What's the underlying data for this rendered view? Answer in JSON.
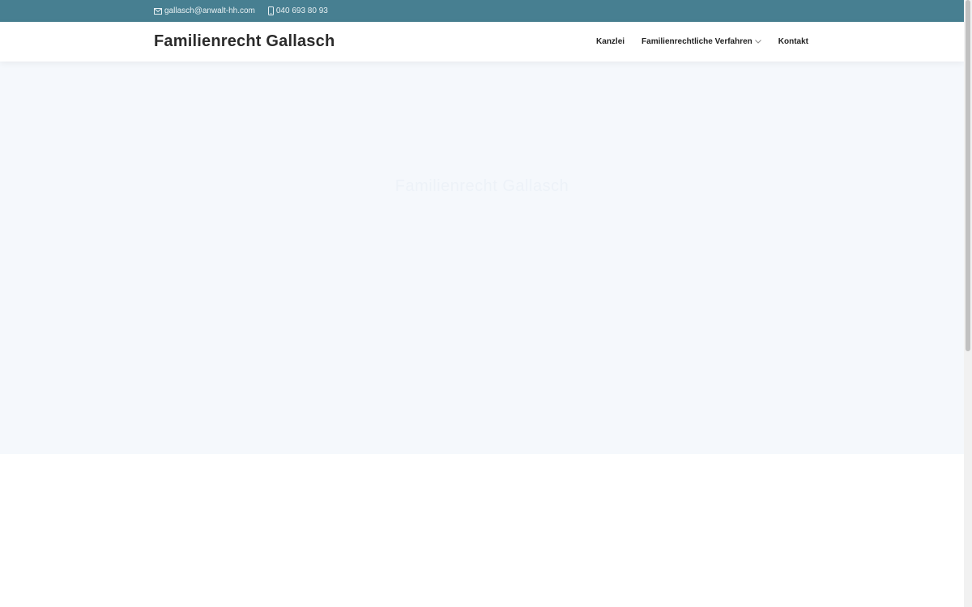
{
  "topbar": {
    "email": "gallasch@anwalt-hh.com",
    "email_icon": "envelope-icon",
    "phone": "040 693 80 93",
    "phone_icon": "mobile-phone-icon",
    "background_color": "#477f91"
  },
  "header": {
    "site_title": "Familienrecht Gallasch",
    "nav": [
      {
        "label": "Kanzlei"
      },
      {
        "label": "Familienrechtliche Verfahren",
        "icon": "chevron-down-icon"
      },
      {
        "label": "Kontakt"
      }
    ]
  },
  "hero": {
    "title": "Familienrecht Gallasch",
    "background_color": "#f5f8fc"
  }
}
